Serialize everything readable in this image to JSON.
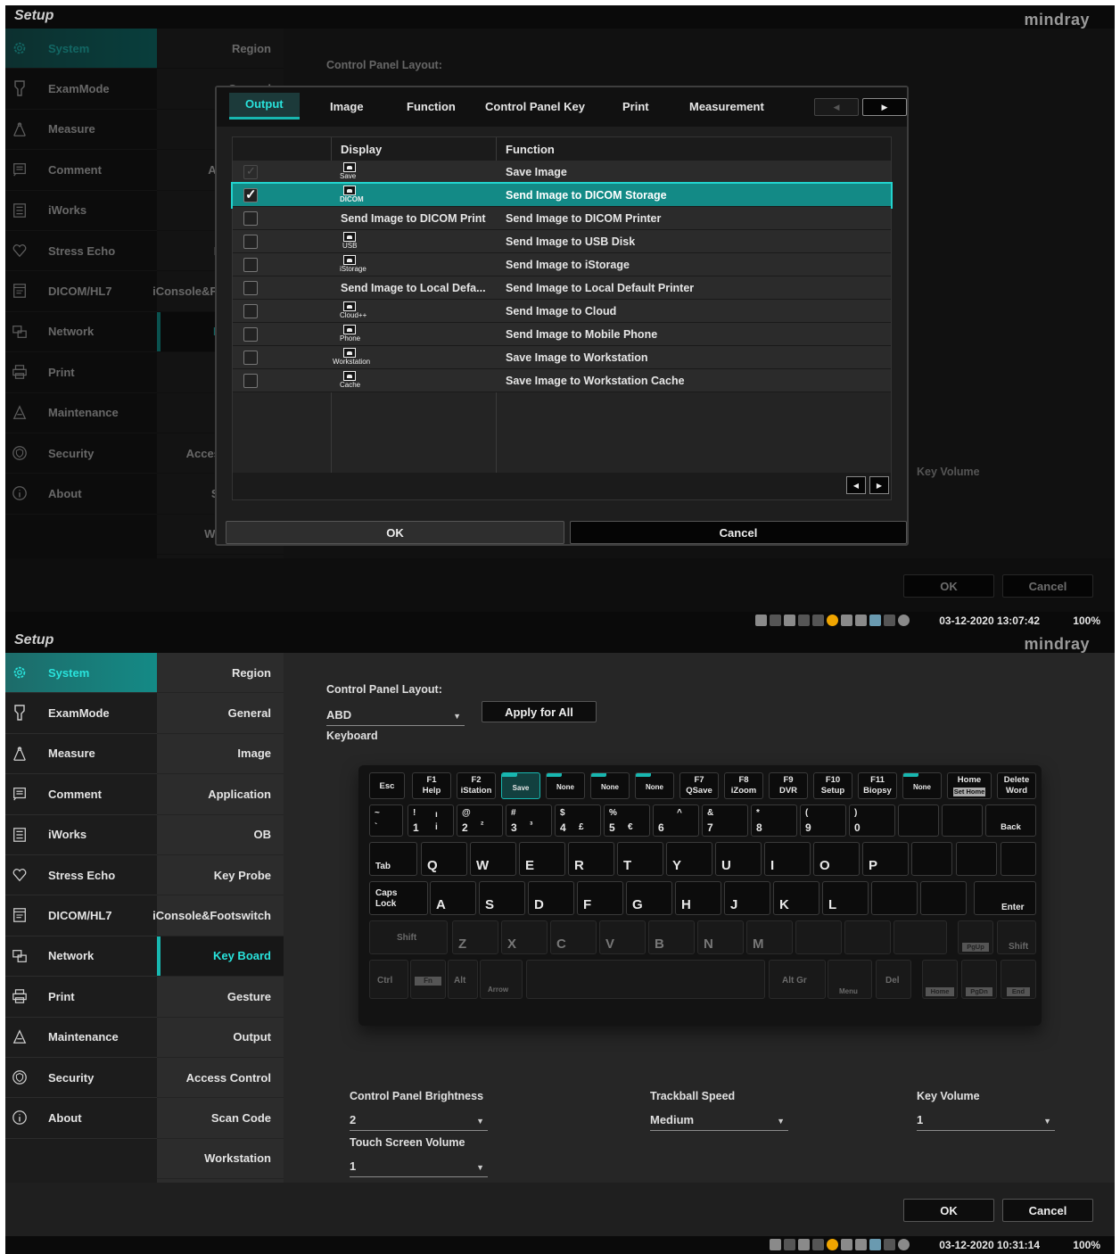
{
  "app": {
    "title": "Setup",
    "brand": "mindray"
  },
  "sidebar": [
    {
      "label": "System",
      "icon": "gear-icon"
    },
    {
      "label": "ExamMode",
      "icon": "probe-icon"
    },
    {
      "label": "Measure",
      "icon": "compass-icon"
    },
    {
      "label": "Comment",
      "icon": "comment-icon"
    },
    {
      "label": "iWorks",
      "icon": "list-icon"
    },
    {
      "label": "Stress Echo",
      "icon": "heart-icon"
    },
    {
      "label": "DICOM/HL7",
      "icon": "dicom-icon"
    },
    {
      "label": "Network",
      "icon": "network-icon"
    },
    {
      "label": "Print",
      "icon": "printer-icon"
    },
    {
      "label": "Maintenance",
      "icon": "maintenance-icon"
    },
    {
      "label": "Security",
      "icon": "shield-icon"
    },
    {
      "label": "About",
      "icon": "info-icon"
    }
  ],
  "subnav": [
    "Region",
    "General",
    "Image",
    "Application",
    "OB",
    "Key Probe",
    "iConsole&Footswitch",
    "Key Board",
    "Gesture",
    "Output",
    "Access Control",
    "Scan Code",
    "Workstation"
  ],
  "keyboard_page": {
    "layout_label": "Control Panel Layout:",
    "layout_value": "ABD",
    "apply_all": "Apply for All",
    "keyboard_label": "Keyboard",
    "brightness_label": "Control Panel Brightness",
    "brightness_value": "2",
    "trackball_label": "Trackball Speed",
    "trackball_value": "Medium",
    "keyvol_label": "Key Volume",
    "keyvol_value": "1",
    "touchvol_label": "Touch Screen Volume",
    "touchvol_value": "1"
  },
  "footer": {
    "ok": "OK",
    "cancel": "Cancel"
  },
  "status1": {
    "time": "03-12-2020 13:07:42",
    "zoom": "100%"
  },
  "status2": {
    "time": "03-12-2020 10:31:14",
    "zoom": "100%"
  },
  "dialog": {
    "tabs": [
      "Output",
      "Image",
      "Function",
      "Control Panel Key",
      "Print",
      "Measurement"
    ],
    "col_display": "Display",
    "col_function": "Function",
    "rows": [
      {
        "display": "Save",
        "function": "Save Image",
        "checked": true,
        "disabled": true
      },
      {
        "display": "DICOM",
        "function": "Send Image to DICOM Storage",
        "checked": true,
        "selected": true
      },
      {
        "display_text": "Send Image to DICOM Print",
        "function": "Send Image to DICOM Printer"
      },
      {
        "display": "USB",
        "function": "Send Image to USB Disk"
      },
      {
        "display": "iStorage",
        "function": "Send Image to iStorage"
      },
      {
        "display_text": "Send Image to Local Defa...",
        "function": "Send Image to Local Default Printer"
      },
      {
        "display": "Cloud++",
        "function": "Send Image to Cloud"
      },
      {
        "display": "Phone",
        "function": "Send Image to Mobile Phone"
      },
      {
        "display": "Workstation",
        "function": "Save Image to Workstation"
      },
      {
        "display": "Cache",
        "function": "Save Image to Workstation Cache"
      }
    ],
    "ok": "OK",
    "cancel": "Cancel"
  },
  "keys": {
    "esc": "Esc",
    "f1": "F1",
    "f1s": "Help",
    "f2": "F2",
    "f2s": "iStation",
    "save": "Save",
    "none": "None",
    "f7": "F7",
    "f7s": "QSave",
    "f8": "F8",
    "f8s": "iZoom",
    "f9": "F9",
    "f9s": "DVR",
    "f10": "F10",
    "f10s": "Setup",
    "f11": "F11",
    "f11s": "Biopsy",
    "home": "Home",
    "sethome": "Set Home",
    "delete": "Delete",
    "word": "Word",
    "back": "Back",
    "tab": "Tab",
    "caps": "Caps",
    "lock": "Lock",
    "enter": "Enter",
    "shift": "Shift",
    "ctrl": "Ctrl",
    "fn": "Fn",
    "alt": "Alt",
    "arrow": "Arrow",
    "altgr": "Alt Gr",
    "menu": "Menu",
    "del": "Del",
    "pgup": "PgUp",
    "pgdn": "PgDn",
    "end": "End",
    "row1": [
      [
        "~",
        "`"
      ],
      [
        "!",
        "1"
      ],
      [
        "@",
        "2"
      ],
      [
        "#",
        "3"
      ],
      [
        "$",
        "4"
      ],
      [
        "%",
        "5"
      ],
      [
        "^",
        "6"
      ],
      [
        "&",
        "7"
      ],
      [
        "*",
        "8"
      ],
      [
        "(",
        "9"
      ],
      [
        ")",
        "0"
      ]
    ],
    "row1b": [
      "ı",
      "i",
      "²",
      "³",
      "£",
      "€"
    ],
    "row2": [
      "Q",
      "W",
      "E",
      "R",
      "T",
      "Y",
      "U",
      "I",
      "O",
      "P"
    ],
    "row3": [
      "A",
      "S",
      "D",
      "F",
      "G",
      "H",
      "J",
      "K",
      "L"
    ],
    "row4": [
      "Z",
      "X",
      "C",
      "V",
      "B",
      "N",
      "M"
    ]
  }
}
